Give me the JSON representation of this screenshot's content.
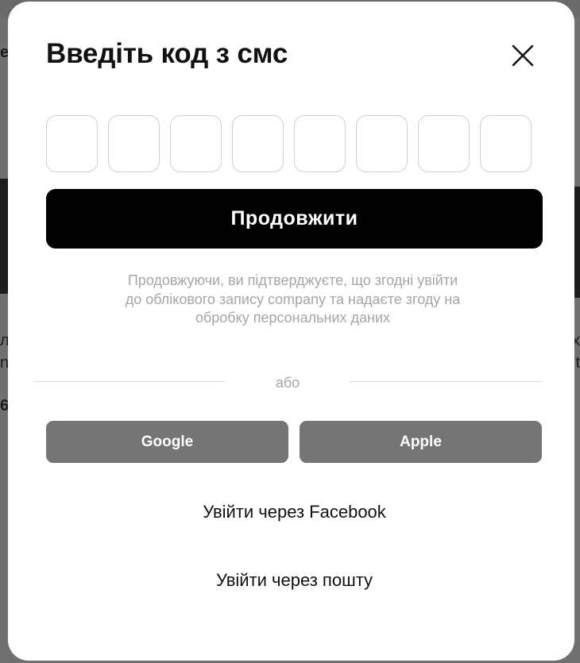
{
  "background": {
    "fragments": {
      "l1": "ен",
      "l2": "ля",
      "l3": "ng",
      "l4": "6",
      "r1": "х",
      "r2": "t"
    }
  },
  "modal": {
    "title": "Введіть код з смс",
    "close_icon": "close-icon",
    "otp": {
      "length": 8,
      "values": [
        "",
        "",
        "",
        "",
        "",
        "",
        "",
        ""
      ]
    },
    "continue_label": "Продовжити",
    "consent_text": "Продовжуючи, ви підтверджуєте, що згодні увійти до облікового запису company та надаєте згоду на обробку персональних даних",
    "divider_text": "або",
    "social": {
      "google_label": "Google",
      "apple_label": "Apple"
    },
    "facebook_link": "Увійти через Facebook",
    "email_link": "Увійти через пошту"
  },
  "colors": {
    "primary_button": "#000000",
    "social_button": "#757575",
    "muted_text": "#a6a6a6",
    "overlay": "#707070"
  }
}
